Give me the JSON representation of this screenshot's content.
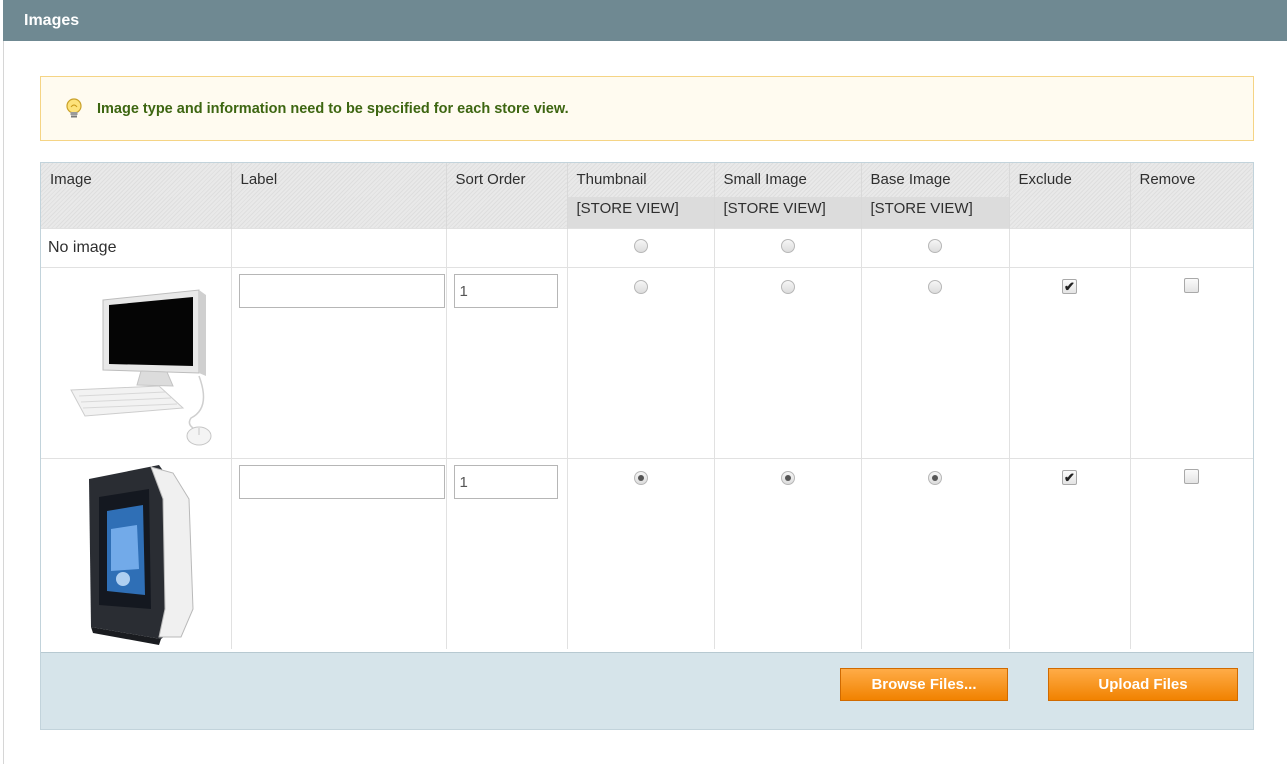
{
  "section": {
    "title": "Images"
  },
  "notice": {
    "text": "Image type and information need to be specified for each store view.",
    "icon": "lightbulb-icon"
  },
  "columns": {
    "image": "Image",
    "label": "Label",
    "sort_order": "Sort Order",
    "thumbnail": "Thumbnail",
    "small_image": "Small Image",
    "base_image": "Base Image",
    "exclude": "Exclude",
    "remove": "Remove",
    "scope": "[STORE VIEW]"
  },
  "no_image_row": {
    "label": "No image"
  },
  "rows": [
    {
      "image": "desktop-computer-image",
      "label": "",
      "sort_order": "1",
      "thumbnail": false,
      "small_image": false,
      "base_image": false,
      "exclude": true,
      "remove": false
    },
    {
      "image": "computer-tower-case-image",
      "label": "",
      "sort_order": "1",
      "thumbnail": true,
      "small_image": true,
      "base_image": true,
      "exclude": true,
      "remove": false
    }
  ],
  "buttons": {
    "browse": "Browse Files...",
    "upload": "Upload Files"
  },
  "colors": {
    "header_bg": "#6f8992",
    "button_orange": "#f18200",
    "footer_bg": "#d6e4ea",
    "notice_text": "#3d6611"
  }
}
